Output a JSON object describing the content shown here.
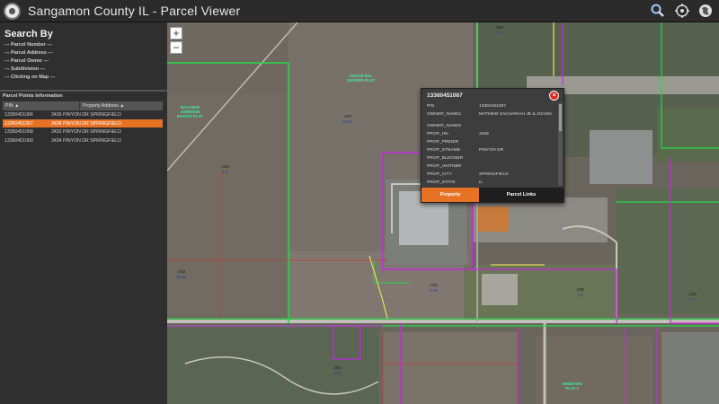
{
  "app": {
    "title": "Sangamon County IL - Parcel Viewer"
  },
  "header": {
    "icons": [
      "search-icon",
      "locate-icon",
      "basemap-icon"
    ]
  },
  "sidebar": {
    "search_title": "Search By",
    "links": [
      "--- Parcel Number ---",
      "--- Parcel Address ---",
      "--- Parcel Owner ---",
      "--- Subdivision ---",
      "--- Clicking on Map ---"
    ],
    "parcel_points": {
      "title": "Parcel Points Information",
      "columns": [
        "PIN ▲",
        "Property Address ▲"
      ],
      "rows": [
        {
          "pin": "13360451066",
          "address": "3436 PINYON DR SPRINGFIELD"
        },
        {
          "pin": "13360451067",
          "address": "3436 PINYON DR SPRINGFIELD",
          "selected": true
        },
        {
          "pin": "13360451068",
          "address": "3432 PINYON DR SPRINGFIELD"
        },
        {
          "pin": "13360451069",
          "address": "3434 PINYON DR SPRINGFIELD"
        }
      ]
    }
  },
  "map": {
    "zoom_in": "+",
    "zoom_out": "−",
    "subdivisions": [
      {
        "text": "BALDWIN\nJOHNSON\nESTATE PLAT"
      },
      {
        "text": "OSCAR BAL\nOXFORD PLAT"
      },
      {
        "text": "ERBSTON\nPLAT 1"
      }
    ],
    "parcels": [
      {
        "pid": ".047",
        "acre": "43.47"
      },
      {
        "pid": ".002",
        "acre": "1.0"
      },
      {
        "pid": ".018",
        "acre": "19.83"
      },
      {
        "pid": ".002",
        "acre": "2.3"
      },
      {
        "pid": ".001",
        "acre": "1.53"
      },
      {
        "pid": ".028",
        "acre": "1.0"
      },
      {
        "pid": ".012",
        "acre": "2.0"
      },
      {
        "pid": ".052",
        "acre": "1.0"
      }
    ]
  },
  "popup": {
    "title": "13360451067",
    "close": "×",
    "attributes": [
      {
        "key": "PIN",
        "value": "13360451067"
      },
      {
        "key": "OWNER_NAME1",
        "value": "MATHEW ZACHARIAH JE & JOANN"
      },
      {
        "key": "OWNER_NAME2",
        "value": ""
      },
      {
        "key": "PROP_HN",
        "value": "3436"
      },
      {
        "key": "PROP_PREDIR",
        "value": ""
      },
      {
        "key": "PROP_STNAME",
        "value": "PINYON DR"
      },
      {
        "key": "PROP_BLDGNBR",
        "value": ""
      },
      {
        "key": "PROP_UNITNBR",
        "value": ""
      },
      {
        "key": "PROP_CITY",
        "value": "SPRINGFIELD"
      },
      {
        "key": "PROP_STATE",
        "value": "IL"
      },
      {
        "key": "PROP_ZIP",
        "value": ""
      }
    ],
    "tabs": [
      "Property",
      "Parcel Links"
    ]
  }
}
